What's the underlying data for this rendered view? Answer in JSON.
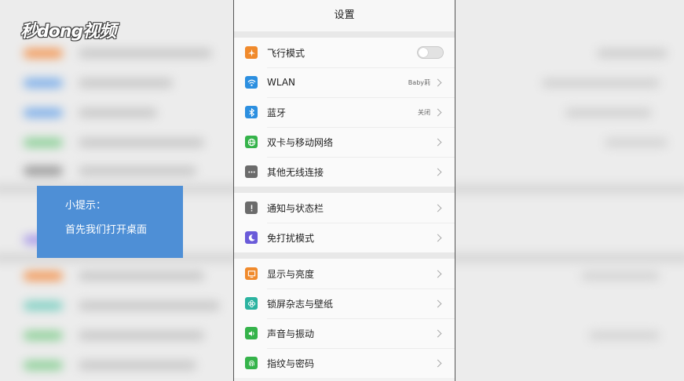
{
  "watermark": {
    "logo_text": "秒dong视频"
  },
  "tip": {
    "title": "小提示：",
    "text": "首先我们打开桌面"
  },
  "settings": {
    "title": "设置",
    "groups": [
      {
        "items": [
          {
            "label": "飞行模式",
            "icon": "airplane-icon",
            "icon_color": "#f08a2c",
            "control": "toggle",
            "toggle_on": false
          },
          {
            "label": "WLAN",
            "icon": "wifi-icon",
            "icon_color": "#2c8fe0",
            "value": "Baby莉"
          },
          {
            "label": "蓝牙",
            "icon": "bluetooth-icon",
            "icon_color": "#2c8fe0",
            "value": "关闭"
          },
          {
            "label": "双卡与移动网络",
            "icon": "globe-icon",
            "icon_color": "#35b34a"
          },
          {
            "label": "其他无线连接",
            "icon": "more-icon",
            "icon_color": "#6b6b6b"
          }
        ]
      },
      {
        "items": [
          {
            "label": "通知与状态栏",
            "icon": "notification-icon",
            "icon_color": "#6b6b6b"
          },
          {
            "label": "免打扰模式",
            "icon": "moon-icon",
            "icon_color": "#6a5bd9"
          }
        ]
      },
      {
        "items": [
          {
            "label": "显示与亮度",
            "icon": "display-icon",
            "icon_color": "#f08a2c"
          },
          {
            "label": "锁屏杂志与壁纸",
            "icon": "flower-icon",
            "icon_color": "#2bb3a0"
          },
          {
            "label": "声音与振动",
            "icon": "speaker-icon",
            "icon_color": "#35b34a"
          },
          {
            "label": "指纹与密码",
            "icon": "fingerprint-icon",
            "icon_color": "#35b34a"
          }
        ]
      }
    ]
  }
}
